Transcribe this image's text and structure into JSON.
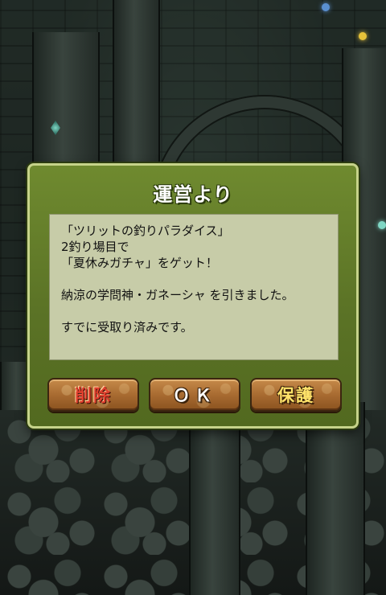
{
  "dialog": {
    "title": "運営より",
    "message_lines": [
      "「ツリットの釣りパラダイス」",
      "2釣り場目で",
      "「夏休みガチャ」をゲット！",
      "",
      "納涼の学問神・ガネーシャ を引きました。",
      "",
      "すでに受取り済みです。"
    ],
    "buttons": {
      "delete_label": "削除",
      "ok_label": "ＯＫ",
      "protect_label": "保護"
    }
  },
  "colors": {
    "dialog_bg": "#5b7326",
    "dialog_border": "#c6d38a",
    "message_bg": "#c7cca8",
    "button_bg": "#a86b31",
    "delete_text": "#e0402e",
    "ok_text": "#ffffff",
    "protect_text": "#ffe36a"
  }
}
